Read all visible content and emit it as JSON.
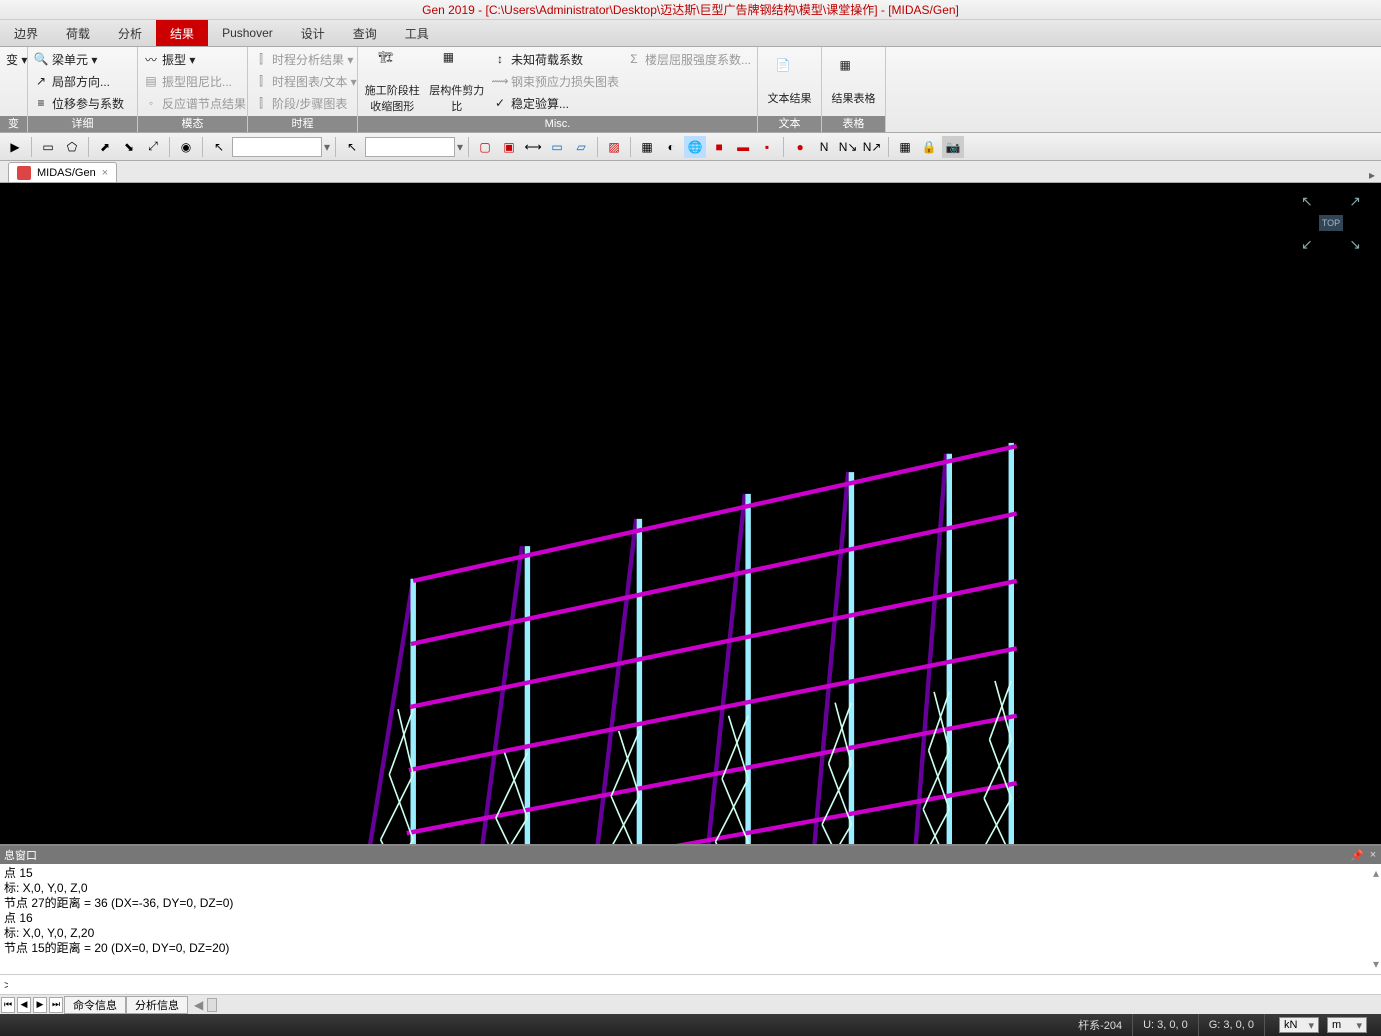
{
  "title": "Gen 2019 - [C:\\Users\\Administrator\\Desktop\\迈达斯\\巨型广告牌钢结构\\模型\\课堂操作] - [MIDAS/Gen]",
  "menu": {
    "items": [
      "边界",
      "荷载",
      "分析",
      "结果",
      "Pushover",
      "设计",
      "查询",
      "工具"
    ],
    "active": 3
  },
  "ribbon": {
    "g0": {
      "label": "变",
      "items": [
        "变 ▾"
      ]
    },
    "g1": {
      "label": "详细",
      "items": [
        "梁单元 ▾",
        "局部方向...",
        "位移参与系数"
      ]
    },
    "g2": {
      "label": "模态",
      "items": [
        "振型 ▾",
        "振型阻尼比...",
        "反应谱节点结果"
      ]
    },
    "g3": {
      "label": "时程",
      "items": [
        "时程分析结果 ▾",
        "时程图表/文本 ▾",
        "阶段/步骤图表"
      ]
    },
    "g4": {
      "label": "Misc.",
      "big": [
        "施工阶段柱收缩图形",
        "层构件剪力比"
      ],
      "items": [
        "未知荷载系数",
        "钢束预应力损失图表",
        "稳定验算..."
      ],
      "items2": [
        "楼层屈服强度系数..."
      ]
    },
    "g5": {
      "label": "文本",
      "big": "文本结果"
    },
    "g6": {
      "label": "表格",
      "big": "结果表格"
    }
  },
  "doctab": {
    "label": "MIDAS/Gen"
  },
  "msg": {
    "title": "息窗口",
    "lines": [
      "点 15",
      "标:  X,0, Y,0, Z,0",
      "节点 27的距离 = 36  (DX=-36, DY=0, DZ=0)",
      "点 16",
      "标:  X,0, Y,0, Z,20",
      "节点 15的距离 = 20  (DX=0, DY=0, DZ=20)"
    ],
    "prompt": ">",
    "tabs": [
      "命令信息",
      "分析信息"
    ]
  },
  "status": {
    "frame": "杆系-204",
    "u": "U: 3, 0, 0",
    "g": "G: 3, 0, 0",
    "unit1": "kN",
    "unit2": "m"
  },
  "viewcube": "TOP"
}
